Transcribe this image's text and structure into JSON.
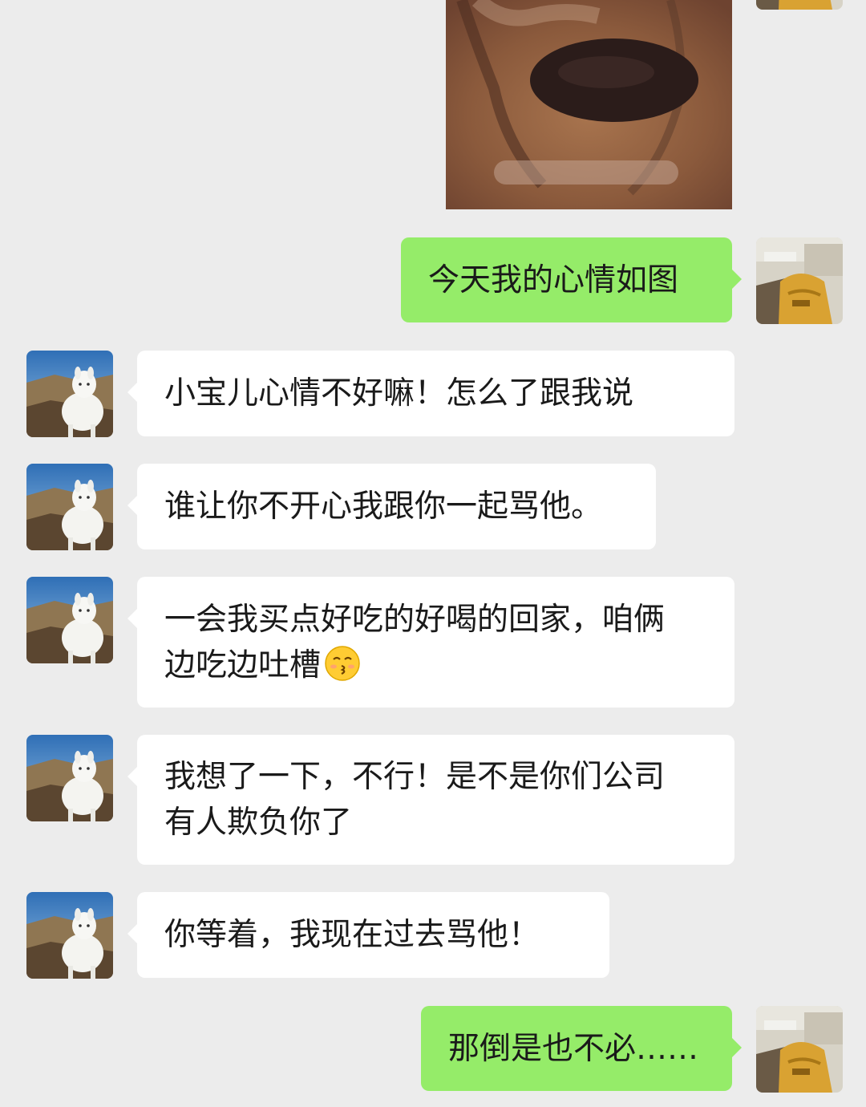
{
  "chat": {
    "sticker": {
      "icon": "dog-face-meme-sticker"
    },
    "messages": [
      {
        "side": "out",
        "lines": [
          "今天我的心情如图"
        ]
      },
      {
        "side": "in",
        "lines": [
          "小宝儿心情不好嘛！怎么了跟我说"
        ]
      },
      {
        "side": "in",
        "lines": [
          "谁让你不开心我跟你一起骂他。"
        ]
      },
      {
        "side": "in",
        "lines": [
          "一会我买点好吃的好喝的回家，咱俩",
          "边吃边吐槽"
        ],
        "emoji": "kissing-face-emoji"
      },
      {
        "side": "in",
        "lines": [
          "我想了一下，不行！是不是你们公司",
          "有人欺负你了"
        ]
      },
      {
        "side": "in",
        "lines": [
          "你等着，我现在过去骂他！"
        ]
      },
      {
        "side": "out",
        "lines": [
          "那倒是也不必……"
        ]
      }
    ],
    "avatars": {
      "self": "person-in-yellow-sweater-avatar",
      "contact": "white-alpaca-avatar"
    },
    "colors": {
      "background": "#ececec",
      "outgoing_bubble": "#95ec69",
      "incoming_bubble": "#ffffff"
    }
  }
}
